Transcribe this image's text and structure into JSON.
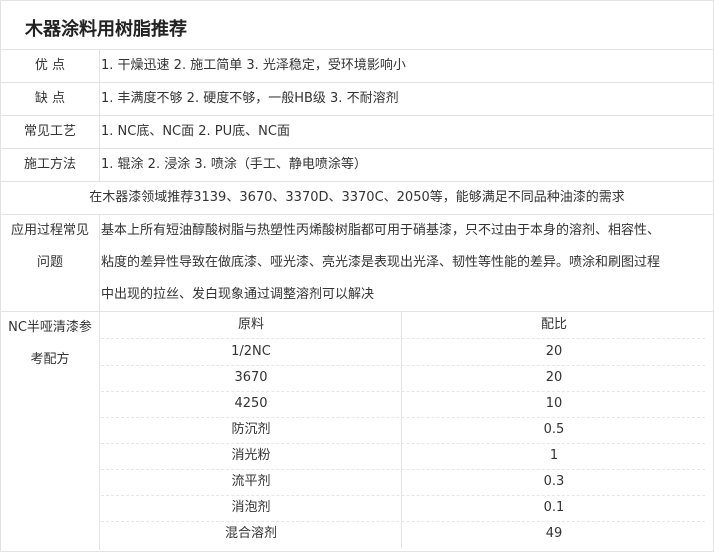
{
  "title": "木器涂料用树脂推荐",
  "rows": {
    "pros": {
      "label": "优 点",
      "value": "1. 干燥迅速 2. 施工简单 3. 光泽稳定，受环境影响小"
    },
    "cons": {
      "label": "缺 点",
      "value": "1. 丰满度不够 2. 硬度不够，一般HB级 3. 不耐溶剂"
    },
    "process": {
      "label": "常见工艺",
      "value": "1. NC底、NC面 2. PU底、NC面"
    },
    "method": {
      "label": "施工方法",
      "value": "1. 辊涂 2. 浸涂 3. 喷涂（手工、静电喷涂等）"
    },
    "recommend": "在木器漆领域推荐3139、3670、3370D、3370C、2050等，能够满足不同品种油漆的需求",
    "issues": {
      "label_line1": "应用过程常见",
      "label_line2": "问题",
      "lines": [
        "基本上所有短油醇酸树脂与热塑性丙烯酸树脂都可用于硝基漆，只不过由于本身的溶剂、相容性、",
        "粘度的差异性导致在做底漆、哑光漆、亮光漆是表现出光泽、韧性等性能的差异。喷涂和刷图过程",
        "中出现的拉丝、发白现象通过调整溶剂可以解决"
      ]
    },
    "formula": {
      "label_line1": "NC半哑清漆参",
      "label_line2": "考配方",
      "header": {
        "material": "原料",
        "ratio": "配比"
      },
      "items": [
        {
          "material": "1/2NC",
          "ratio": "20"
        },
        {
          "material": "3670",
          "ratio": "20"
        },
        {
          "material": "4250",
          "ratio": "10"
        },
        {
          "material": "防沉剂",
          "ratio": "0.5"
        },
        {
          "material": "消光粉",
          "ratio": "1"
        },
        {
          "material": "流平剂",
          "ratio": "0.3"
        },
        {
          "material": "消泡剂",
          "ratio": "0.1"
        },
        {
          "material": "混合溶剂",
          "ratio": "49"
        }
      ]
    }
  }
}
